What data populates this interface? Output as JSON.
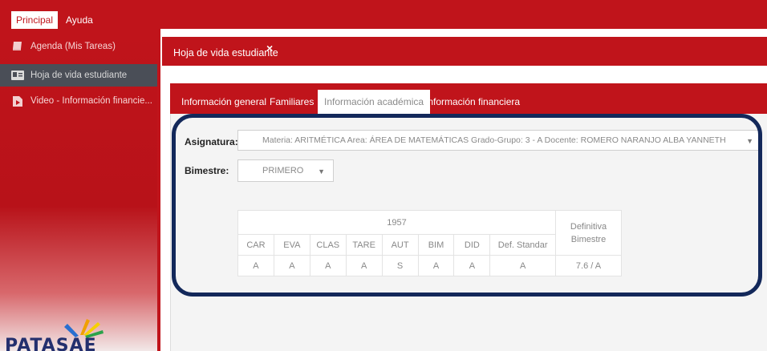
{
  "menu": {
    "tabs": [
      "Principal",
      "Ayuda"
    ]
  },
  "sidebar": {
    "items": [
      {
        "label": "Agenda (Mis Tareas)",
        "icon": "book-icon"
      },
      {
        "label": "Hoja de vida estudiante",
        "icon": "id-card-icon"
      },
      {
        "label": "Video - Información financie...",
        "icon": "video-file-icon"
      }
    ],
    "logo_text": "PATASAE"
  },
  "document_tab": {
    "title": "Hoja de vida estudiante",
    "close": "×"
  },
  "tabs": [
    "Información general",
    "Familiares",
    "Información académica",
    "Información financiera"
  ],
  "form": {
    "asignatura_label": "Asignatura",
    "asignatura_value": "Materia: ARITMÉTICA Area: ÁREA DE MATEMÁTICAS Grado-Grupo: 3 - A Docente: ROMERO NARANJO ALBA YANNETH",
    "bimestre_label": "Bimestre",
    "bimestre_value": "PRIMERO"
  },
  "grades": {
    "group_header": "1957",
    "final_header": "Definitiva Bimestre",
    "columns": [
      "CAR",
      "EVA",
      "CLAS",
      "TARE",
      "AUT",
      "BIM",
      "DID",
      "Def. Standar"
    ],
    "values": [
      "A",
      "A",
      "A",
      "A",
      "S",
      "A",
      "A",
      "A"
    ],
    "final_value": "7.6 / A"
  },
  "colors": {
    "brand_red": "#c0141b",
    "highlight_outline": "#13285a",
    "selected_sidebar": "#4a4e57"
  }
}
